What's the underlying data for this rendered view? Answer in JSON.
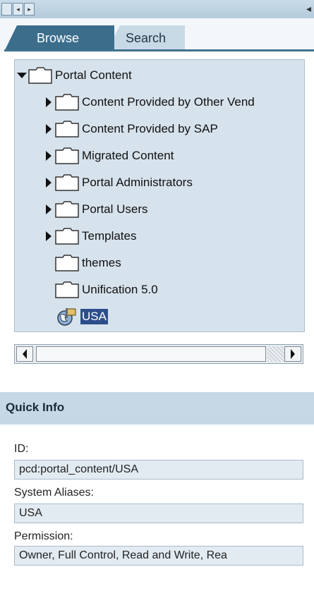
{
  "nav": {
    "left_glyph": "◂",
    "right_glyph": "▸"
  },
  "tabs": [
    {
      "label": "Browse",
      "active": true
    },
    {
      "label": "Search",
      "active": false
    }
  ],
  "tree": {
    "root": {
      "label": "Portal Content",
      "expanded": true
    },
    "items": [
      {
        "label": "Content Provided by Other Vend",
        "has_children": true
      },
      {
        "label": "Content Provided by SAP",
        "has_children": true
      },
      {
        "label": "Migrated Content",
        "has_children": true
      },
      {
        "label": "Portal Administrators",
        "has_children": true
      },
      {
        "label": "Portal Users",
        "has_children": true
      },
      {
        "label": "Templates",
        "has_children": true
      },
      {
        "label": "themes",
        "has_children": false
      },
      {
        "label": "Unification 5.0",
        "has_children": false
      },
      {
        "label": "USA",
        "selected": true,
        "icon": "globe-role-icon"
      }
    ]
  },
  "quick_info": {
    "title": "Quick Info",
    "id_label": "ID:",
    "id_value": "pcd:portal_content/USA",
    "aliases_label": "System Aliases:",
    "aliases_value": "USA",
    "permission_label": "Permission:",
    "permission_value": "Owner, Full Control, Read and Write, Rea"
  },
  "colors": {
    "tab_active": "#3c6e8c",
    "tab_inactive": "#c8d9e6",
    "tree_bg": "#d6e2ec",
    "selection": "#2c4f8c"
  }
}
